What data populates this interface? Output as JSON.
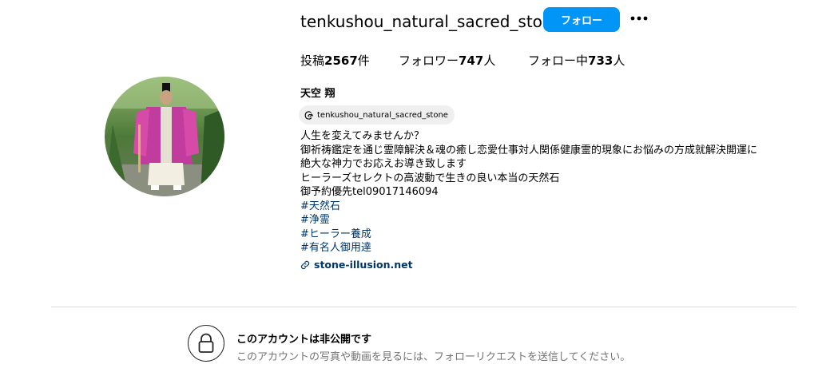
{
  "profile": {
    "username": "tenkushou_natural_sacred_stone",
    "follow_label": "フォロー",
    "more_label": "•••",
    "stats": {
      "posts_prefix": "投稿",
      "posts_count": "2567",
      "posts_suffix": "件",
      "followers_prefix": "フォロワー",
      "followers_count": "747",
      "followers_suffix": "人",
      "following_prefix": "フォロー中",
      "following_count": "733",
      "following_suffix": "人"
    },
    "display_name": "天空 翔",
    "threads_handle": "tenkushou_natural_sacred_stone",
    "bio_lines": [
      "人生を変えてみませんか？",
      "御祈祷鑑定を通じ霊障解決＆魂の癒し恋愛仕事対人関係健康霊的現象にお悩みの方成就解決開運に",
      "絶大な神力でお応えお導き致します",
      "ヒーラーズセレクトの高波動で生きの良い本当の天然石",
      "御予約優先tel09017146094"
    ],
    "hashtags": [
      "#天然石",
      "#浄霊",
      "#ヒーラー養成",
      "#有名人御用達"
    ],
    "link": "stone-illusion.net"
  },
  "private_notice": {
    "title": "このアカウントは非公開です",
    "description": "このアカウントの写真や動画を見るには、フォローリクエストを送信してください。"
  },
  "colors": {
    "follow_button": "#0095f6",
    "link": "#00376b",
    "muted_text": "#737373",
    "divider": "#dbdbdb",
    "pill_bg": "#efefef"
  },
  "icons": {
    "threads": "threads-icon",
    "link": "link-icon",
    "lock": "lock-icon",
    "more": "more-options-icon"
  }
}
